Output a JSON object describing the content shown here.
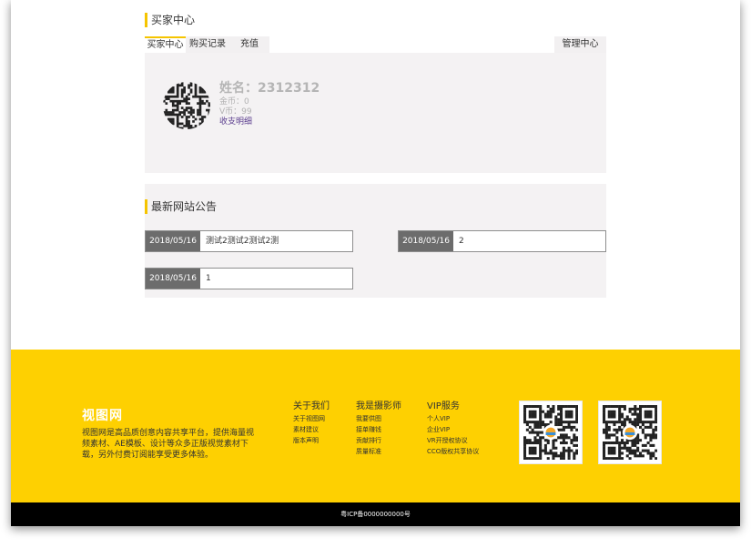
{
  "buyer_center": {
    "title": "买家中心",
    "tabs": [
      "买家中心",
      "购买记录",
      "充值"
    ],
    "manage_label": "管理中心",
    "profile": {
      "name": "姓名：2312312",
      "gold": "金币：0",
      "vcoin": "V币：99",
      "detail_link": "收支明细"
    }
  },
  "announcements": {
    "title": "最新网站公告",
    "items": [
      {
        "date": "2018/05/16",
        "text": "测试2测试2测试2测"
      },
      {
        "date": "2018/05/16",
        "text": "2"
      },
      {
        "date": "2018/05/16",
        "text": "1"
      }
    ]
  },
  "footer": {
    "brand": "视图网",
    "description": "视图网是高品质创意内容共享平台，提供海量视频素材、AE模板、设计等众多正版视觉素材下载，另外付费订阅能享受更多体验。",
    "columns": [
      {
        "title": "关于我们",
        "items": [
          "关于视图网",
          "素材建议",
          "版本声明"
        ]
      },
      {
        "title": "我是摄影师",
        "items": [
          "我要供图",
          "接单赚钱",
          "贡献排行",
          "质量标准"
        ]
      },
      {
        "title": "VIP服务",
        "items": [
          "个人VIP",
          "企业VIP",
          "VR开授权协议",
          "CCO版权共享协议"
        ]
      }
    ],
    "icp": "粤ICP备0000000000号"
  },
  "colors": {
    "accent": "#f5c400",
    "footer_bg": "#fed001",
    "panel_bg": "#f4f2f3",
    "date_bg": "#6c6c6c"
  },
  "icons": {
    "avatar": "qr-code-avatar",
    "footer_qr": "qr-code-icon"
  }
}
